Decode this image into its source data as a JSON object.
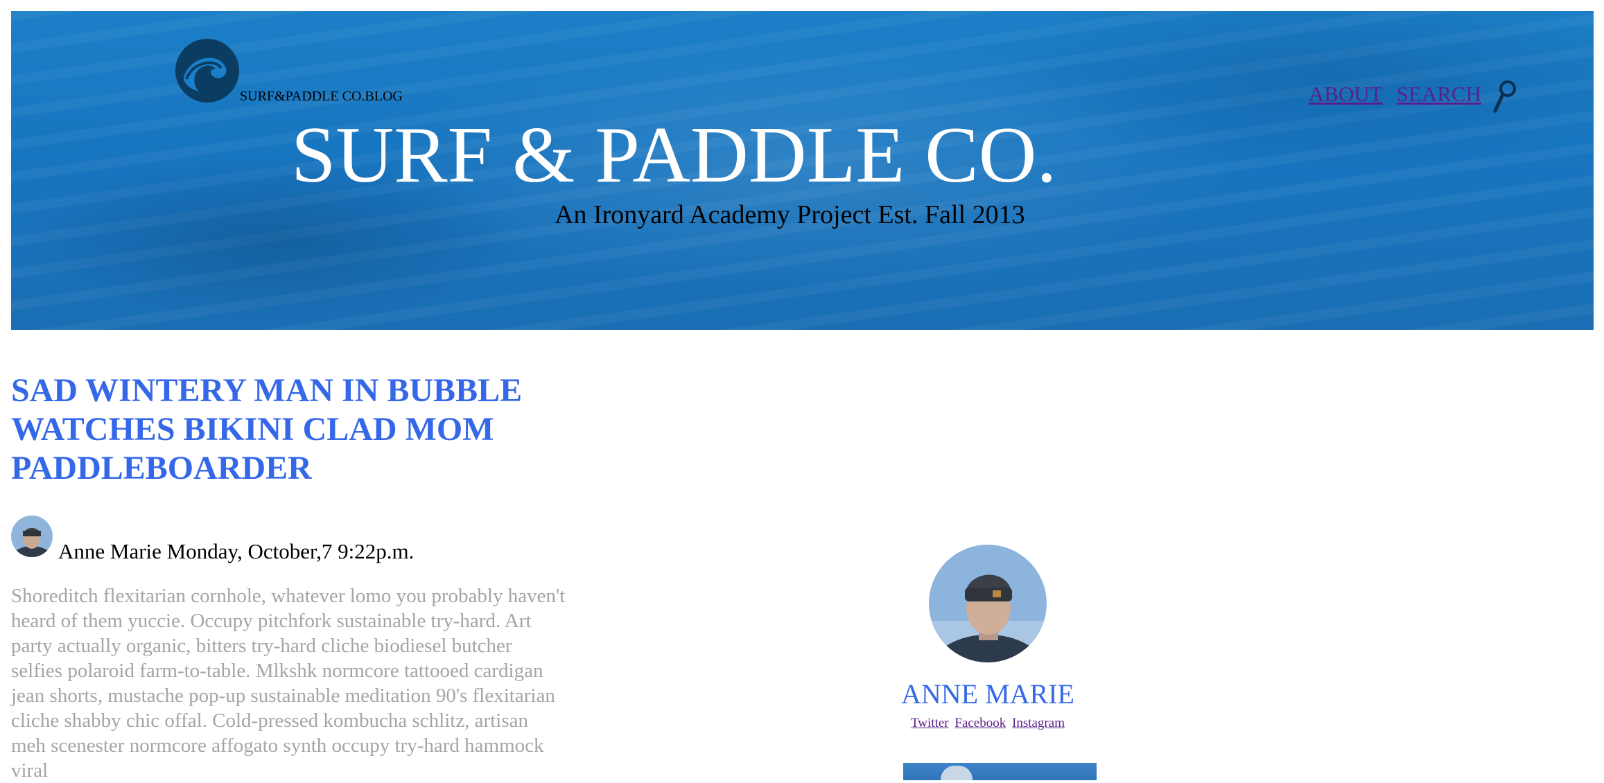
{
  "header": {
    "blog_name": "SURF&PADDLE CO.BLOG",
    "site_title": "SURF & PADDLE CO.",
    "tagline": "An Ironyard Academy Project Est. Fall 2013",
    "nav": [
      {
        "label": "ABOUT"
      },
      {
        "label": "SEARCH"
      }
    ],
    "logo_icon": "wave-logo-icon",
    "search_icon": "magnifier-icon"
  },
  "post": {
    "title": "SAD WINTERY MAN IN BUBBLE WATCHES BIKINI CLAD MOM PADDLEBOARDER",
    "author": "Anne Marie",
    "date": "Monday, October,7 9:22p.m.",
    "body": "Shoreditch flexitarian cornhole, whatever lomo you probably haven't heard of them yuccie. Occupy pitchfork sustainable try-hard. Art party actually organic, bitters try-hard cliche biodiesel butcher selfies polaroid farm-to-table. Mlkshk normcore tattooed cardigan jean shorts, mustache pop-up sustainable meditation 90's flexitarian cliche shabby chic offal. Cold-pressed kombucha schlitz, artisan meh scenester normcore affogato synth occupy try-hard hammock viral"
  },
  "author_card": {
    "name": "ANNE MARIE",
    "socials": [
      {
        "label": "Twitter"
      },
      {
        "label": "Facebook"
      },
      {
        "label": "Instagram"
      }
    ]
  },
  "colors": {
    "hero_blue": "#1875bf",
    "title_blue": "#3568e8",
    "link_purple": "#5a1f8c",
    "body_gray": "#a5a5a5"
  }
}
